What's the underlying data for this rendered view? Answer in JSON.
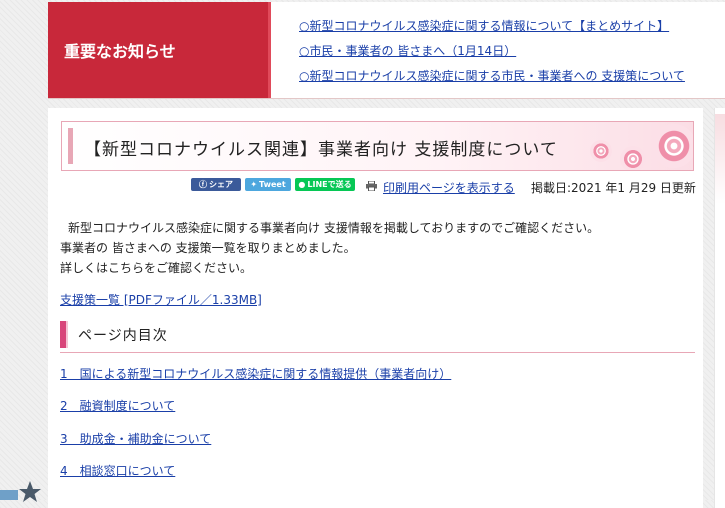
{
  "notice": {
    "label": "重要なお知らせ",
    "links": [
      "○新型コロナウイルス感染症に関する情報について【まとめサイト】",
      "○市民・事業者の 皆さまへ（1月14日）",
      "○新型コロナウイルス感染症に関する市民・事業者への 支援策について"
    ]
  },
  "page": {
    "title": "【新型コロナウイルス関連】事業者向け 支援制度について",
    "share": {
      "facebook": "シェア",
      "twitter": "Tweet",
      "line": "LINEで送る"
    },
    "print_link": "印刷用ページを表示する",
    "posted_date": "掲載日:2021 年1 月29 日更新",
    "intro": [
      "新型コロナウイルス感染症に関する事業者向け 支援情報を掲載しておりますのでご確認ください。",
      "事業者の 皆さまへの 支援策一覧を取りまとめました。",
      "詳しくはこちらをご確認ください。"
    ],
    "pdf_link": "支援策一覧 [PDFファイル／1.33MB]",
    "toc_title": "ページ内目次",
    "toc": [
      "1　国による新型コロナウイルス感染症に関する情報提供（事業者向け）",
      "2　融資制度について",
      "3　助成金・補助金について",
      "4　相談窓口について"
    ]
  },
  "icons": [
    "facebook-icon",
    "twitter-bird-icon",
    "line-icon",
    "printer-icon",
    "rose-decoration",
    "star-icon"
  ],
  "colors": {
    "notice_red": "#c8283a",
    "accent_pink": "#e8a7b6",
    "link_blue": "#1a3fa8",
    "facebook": "#3b5a9a",
    "twitter": "#4da7de",
    "line": "#06c755"
  }
}
